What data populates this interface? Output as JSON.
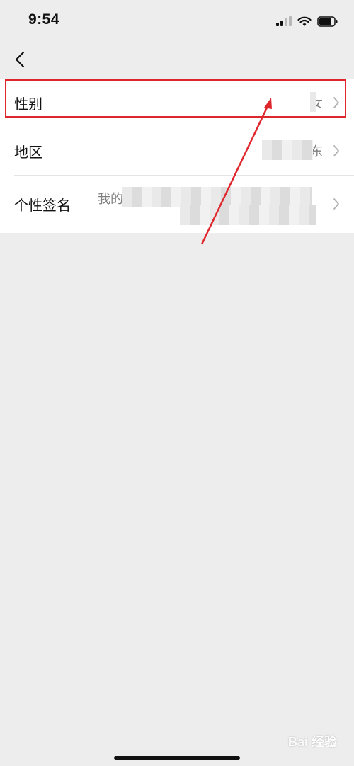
{
  "status_bar": {
    "time": "9:54",
    "icons": [
      "signal-icon",
      "wifi-icon",
      "battery-icon"
    ]
  },
  "nav": {
    "back_icon": "chevron-left-icon"
  },
  "settings": {
    "rows": [
      {
        "label": "性别",
        "value": "女"
      },
      {
        "label": "地区",
        "value": "东"
      },
      {
        "label": "个性签名",
        "value": "我的"
      }
    ]
  },
  "annotation": {
    "color": "#e0262d"
  },
  "watermark": {
    "text": "Bai 经验"
  },
  "colors": {
    "page_background": "#ededed",
    "row_background": "#ffffff",
    "value_text": "#7f7f7f"
  }
}
